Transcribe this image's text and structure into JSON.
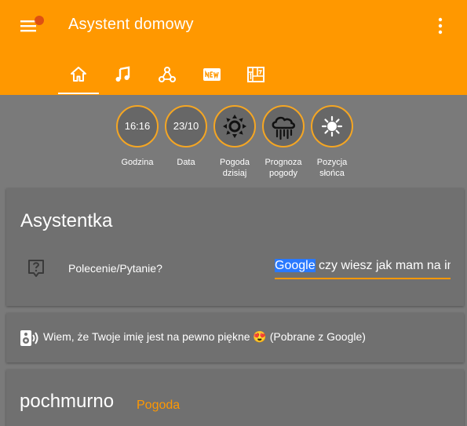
{
  "app": {
    "title": "Asystent domowy"
  },
  "icons": {
    "menu": "menu-icon",
    "more": "more-vert-icon",
    "tabs": [
      "home-icon",
      "music-note-icon",
      "hub-icon",
      "new-box-icon",
      "dashboard-icon"
    ],
    "weather": [
      "sun-gear-icon",
      "rain-cloud-icon",
      "sun-icon"
    ],
    "question": "help-box-icon",
    "speaker": "speaker-icon"
  },
  "colors": {
    "header": "#ff9800",
    "background": "#7a7a7a",
    "card": "#707070",
    "accent": "#ff9800",
    "badge_ring": "#f5a623",
    "highlight": "#2979ff"
  },
  "badges": [
    {
      "value": "16:16",
      "label": "Godzina"
    },
    {
      "value": "23/10",
      "label": "Data"
    },
    {
      "value": "",
      "label": "Pogoda dzisiaj"
    },
    {
      "value": "",
      "label": "Prognoza pogody"
    },
    {
      "value": "",
      "label": "Pozycja słońca"
    }
  ],
  "assistant": {
    "title": "Asystentka",
    "question_label": "Polecenie/Pytanie?",
    "input_highlight": "Google",
    "input_rest": " czy wiesz jak mam na imię"
  },
  "response": {
    "text": "Wiem, że Twoje imię jest na pewno piękne 😍 (Pobrane z Google)"
  },
  "weather": {
    "state": "pochmurno",
    "label": "Pogoda"
  }
}
